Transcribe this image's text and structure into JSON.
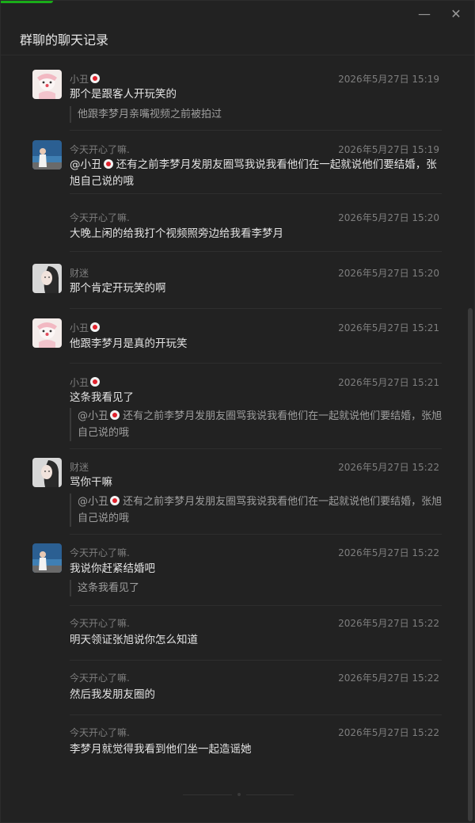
{
  "window": {
    "title": "群聊的聊天记录",
    "minimize_glyph": "—",
    "close_glyph": "✕"
  },
  "messages": [
    {
      "sender": "小丑",
      "time": "2026年5月27日 15:19",
      "text": "那个是跟客人开玩笑的",
      "quote": "他跟李梦月亲嘴视频之前被拍过",
      "avatar": "clown-avatar"
    },
    {
      "sender": "今天开心了嘛.",
      "time": "2026年5月27日 15:19",
      "text_prefix": "@小丑",
      "text": "还有之前李梦月发朋友圈骂我说我看他们在一起就说他们要结婚，张旭自己说的哦",
      "avatar": "beach-avatar"
    },
    {
      "sender": "今天开心了嘛.",
      "time": "2026年5月27日 15:20",
      "text": "大晚上闲的给我打个视频照旁边给我看李梦月"
    },
    {
      "sender": "财迷",
      "time": "2026年5月27日 15:20",
      "text": "那个肯定开玩笑的啊",
      "avatar": "girl-avatar"
    },
    {
      "sender": "小丑",
      "time": "2026年5月27日 15:21",
      "text": "他跟李梦月是真的开玩笑",
      "avatar": "clown-avatar"
    },
    {
      "sender": "小丑",
      "time": "2026年5月27日 15:21",
      "text": "这条我看见了",
      "quote_prefix": "@小丑",
      "quote": "还有之前李梦月发朋友圈骂我说我看他们在一起就说他们要结婚，张旭自己说的哦"
    },
    {
      "sender": "财迷",
      "time": "2026年5月27日 15:22",
      "text": "骂你干嘛",
      "quote_prefix": "@小丑",
      "quote": "还有之前李梦月发朋友圈骂我说我看他们在一起就说他们要结婚，张旭自己说的哦",
      "avatar": "girl-avatar"
    },
    {
      "sender": "今天开心了嘛.",
      "time": "2026年5月27日 15:22",
      "text": "我说你赶紧结婚吧",
      "quote": "这条我看见了",
      "avatar": "beach-avatar"
    },
    {
      "sender": "今天开心了嘛.",
      "time": "2026年5月27日 15:22",
      "text": "明天领证张旭说你怎么知道"
    },
    {
      "sender": "今天开心了嘛.",
      "time": "2026年5月27日 15:22",
      "text": "然后我发朋友圈的"
    },
    {
      "sender": "今天开心了嘛.",
      "time": "2026年5月27日 15:22",
      "text": "李梦月就觉得我看到他们坐一起造谣她"
    }
  ],
  "colors": {
    "background": "#222222",
    "text": "#e3e3e3",
    "muted": "#7e7e7e",
    "accent": "#1aad19"
  }
}
